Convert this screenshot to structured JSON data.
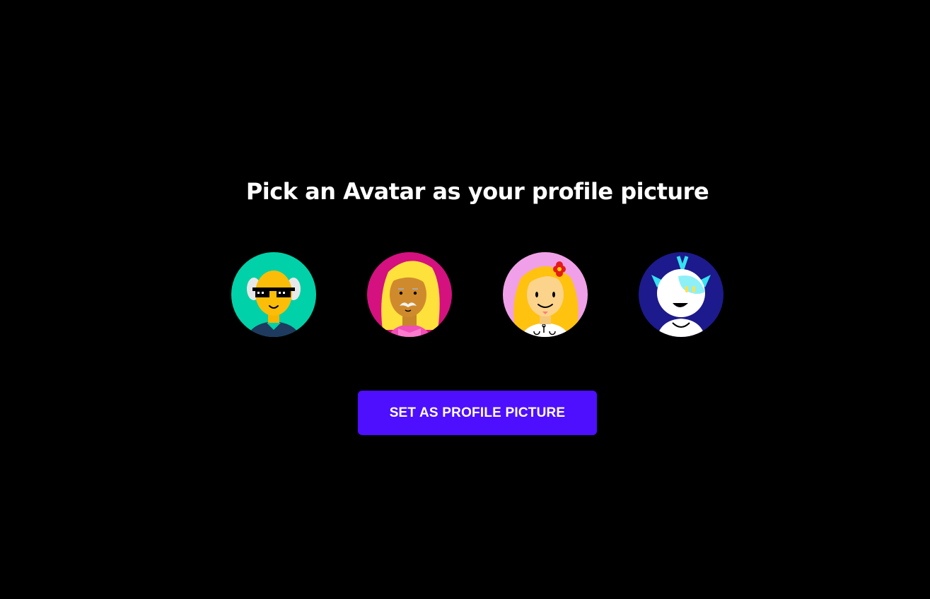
{
  "heading": "Pick an Avatar as your profile picture",
  "avatars": [
    {
      "icon": "old-man-sunglasses-avatar-icon",
      "background": "#00d1a8"
    },
    {
      "icon": "mustache-blonde-avatar-icon",
      "background": "#d4117f"
    },
    {
      "icon": "flower-girl-avatar-icon",
      "background": "#f0a0e8"
    },
    {
      "icon": "robot-avatar-icon",
      "background": "#1c1a8c"
    }
  ],
  "button": {
    "label": "SET AS PROFILE PICTURE",
    "color": "#4e0eff"
  }
}
